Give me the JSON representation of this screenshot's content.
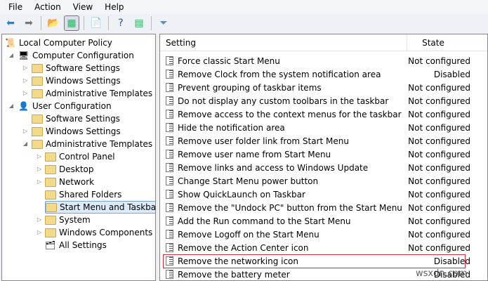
{
  "menu": [
    "File",
    "Action",
    "View",
    "Help"
  ],
  "toolbar": [
    {
      "icon": "back-arrow-icon",
      "glyph": "⬅"
    },
    {
      "icon": "forward-arrow-icon",
      "glyph": "➡"
    },
    {
      "icon": "up-folder-icon",
      "glyph": "📂"
    },
    {
      "icon": "show-hide-tree-icon",
      "glyph": "▦"
    },
    {
      "icon": "export-list-icon",
      "glyph": "📄"
    },
    {
      "icon": "help-icon",
      "glyph": "?"
    },
    {
      "icon": "properties-pane-icon",
      "glyph": "▤"
    },
    {
      "icon": "filter-icon",
      "glyph": "⏷"
    }
  ],
  "tree": [
    {
      "label": "Local Computer Policy",
      "level": 0,
      "icon": "policy",
      "arrow": ""
    },
    {
      "label": "Computer Configuration",
      "level": 1,
      "icon": "computer",
      "arrow": "◢"
    },
    {
      "label": "Software Settings",
      "level": 2,
      "icon": "folder",
      "arrow": "▷"
    },
    {
      "label": "Windows Settings",
      "level": 2,
      "icon": "folder",
      "arrow": "▷"
    },
    {
      "label": "Administrative Templates",
      "level": 2,
      "icon": "folder",
      "arrow": "▷"
    },
    {
      "label": "User Configuration",
      "level": 1,
      "icon": "user",
      "arrow": "◢"
    },
    {
      "label": "Software Settings",
      "level": 2,
      "icon": "folder",
      "arrow": ""
    },
    {
      "label": "Windows Settings",
      "level": 2,
      "icon": "folder",
      "arrow": "▷"
    },
    {
      "label": "Administrative Templates",
      "level": 2,
      "icon": "folder",
      "arrow": "◢"
    },
    {
      "label": "Control Panel",
      "level": 3,
      "icon": "folder",
      "arrow": "▷"
    },
    {
      "label": "Desktop",
      "level": 3,
      "icon": "folder",
      "arrow": "▷"
    },
    {
      "label": "Network",
      "level": 3,
      "icon": "folder",
      "arrow": "▷"
    },
    {
      "label": "Shared Folders",
      "level": 3,
      "icon": "folder",
      "arrow": ""
    },
    {
      "label": "Start Menu and Taskbar",
      "level": 3,
      "icon": "folder",
      "arrow": "",
      "selected": true
    },
    {
      "label": "System",
      "level": 3,
      "icon": "folder",
      "arrow": "▷"
    },
    {
      "label": "Windows Components",
      "level": 3,
      "icon": "folder",
      "arrow": "▷"
    },
    {
      "label": "All Settings",
      "level": 3,
      "icon": "allsettings",
      "arrow": ""
    }
  ],
  "columns": {
    "setting": "Setting",
    "state": "State"
  },
  "rows": [
    {
      "setting": "Force classic Start Menu",
      "state": "Not configured"
    },
    {
      "setting": "Remove Clock from the system notification area",
      "state": "Disabled"
    },
    {
      "setting": "Prevent grouping of taskbar items",
      "state": "Not configured"
    },
    {
      "setting": "Do not display any custom toolbars in the taskbar",
      "state": "Not configured"
    },
    {
      "setting": "Remove access to the context menus for the taskbar",
      "state": "Not configured"
    },
    {
      "setting": "Hide the notification area",
      "state": "Not configured"
    },
    {
      "setting": "Remove user folder link from Start Menu",
      "state": "Not configured"
    },
    {
      "setting": "Remove user name from Start Menu",
      "state": "Not configured"
    },
    {
      "setting": "Remove links and access to Windows Update",
      "state": "Not configured"
    },
    {
      "setting": "Change Start Menu power button",
      "state": "Not configured"
    },
    {
      "setting": "Show QuickLaunch on Taskbar",
      "state": "Not configured"
    },
    {
      "setting": "Remove the \"Undock PC\" button from the Start Menu",
      "state": "Not configured"
    },
    {
      "setting": "Add the Run command to the Start Menu",
      "state": "Not configured"
    },
    {
      "setting": "Remove Logoff on the Start Menu",
      "state": "Not configured"
    },
    {
      "setting": "Remove the Action Center icon",
      "state": "Not configured"
    },
    {
      "setting": "Remove the networking icon",
      "state": "Disabled"
    },
    {
      "setting": "Remove the battery meter",
      "state": "Disabled"
    }
  ],
  "watermark": "wsxdn.com",
  "colors": {
    "highlight_border": "#d0303a",
    "selection": "#dcebfc"
  }
}
